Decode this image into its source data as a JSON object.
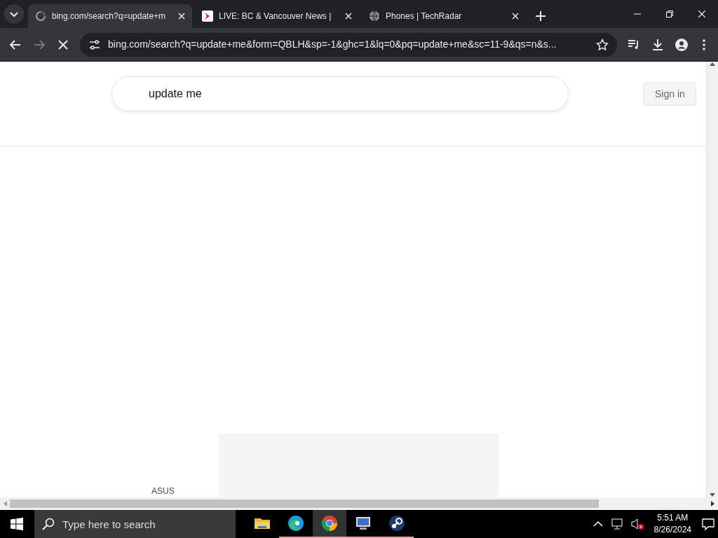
{
  "tabs": [
    {
      "title": "bing.com/search?q=update+m",
      "kind": "loading",
      "selected": true
    },
    {
      "title": "LIVE: BC & Vancouver News |",
      "kind": "news",
      "selected": false
    },
    {
      "title": "Phones | TechRadar",
      "kind": "globe",
      "selected": false
    }
  ],
  "address_bar": {
    "url": "bing.com/search?q=update+me&form=QBLH&sp=-1&ghc=1&lq=0&pq=update+me&sc=11-9&qs=n&s..."
  },
  "page": {
    "search_value": "update me",
    "sign_in": "Sign in",
    "bottom_label": "ASUS"
  },
  "taskbar": {
    "search_placeholder": "Type here to search",
    "apps": [
      {
        "kind": "folder",
        "open": false,
        "selected": false
      },
      {
        "kind": "edge",
        "open": true,
        "selected": false
      },
      {
        "kind": "chrome",
        "open": true,
        "selected": true
      },
      {
        "kind": "monitor",
        "open": true,
        "selected": false
      },
      {
        "kind": "steam",
        "open": true,
        "selected": false
      }
    ],
    "time": "5:51 AM",
    "date": "8/26/2024"
  }
}
